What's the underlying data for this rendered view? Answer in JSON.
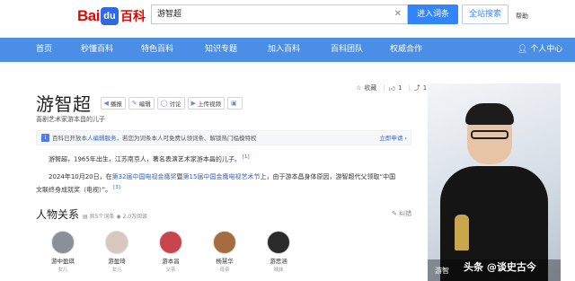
{
  "header": {
    "logo_bai": "Bai",
    "logo_du": "du",
    "logo_ke": "百科",
    "search_value": "游智超",
    "enter_button": "进入词条",
    "all_search_button": "全站搜索",
    "help": "帮助"
  },
  "nav": {
    "items": [
      "首页",
      "秒懂百科",
      "特色百科",
      "知识专题",
      "加入百科",
      "百科团队",
      "权威合作"
    ],
    "user": "个人中心"
  },
  "entry": {
    "title": "游智超",
    "tools": [
      "播报",
      "编辑",
      "讨论",
      "上传视频"
    ],
    "subtitle": "喜剧艺术家游本昌的儿子",
    "collect": "收藏",
    "like_count": "1",
    "share_count": "1"
  },
  "notice": {
    "prefix": "百科已开放",
    "link": "本人编辑服务",
    "text": "，若您为词条本人可免费认领词条、解锁热门榀模特权",
    "apply": "立即申请 ›"
  },
  "paragraphs": {
    "p1": "游智超，1965年出生，江苏南京人，著名表演艺术家游本昌的儿子。",
    "p1_ref": "[1]",
    "p2_a": "2024年10月20日，在",
    "p2_link1": "第32届中国电视金鹰奖",
    "p2_b": "暨",
    "p2_link2": "第15届中国金鹰电视艺术节",
    "p2_c": "上，由于游本昌身体原因，游智超代父领取“中国",
    "p3": "文联终身成就奖（电视）”。",
    "p3_ref": "[3]"
  },
  "relations": {
    "title": "人物关系",
    "meta_count": "共5个词条",
    "meta_views": "2.0万阅读",
    "edit": "纠错",
    "people": [
      {
        "name": "游中盈琪",
        "relation": "女儿",
        "color": "#8a8f99"
      },
      {
        "name": "游盈琦",
        "relation": "女儿",
        "color": "#d8c7bd"
      },
      {
        "name": "游本昌",
        "relation": "父亲",
        "color": "#c9454e"
      },
      {
        "name": "杨慧华",
        "relation": "母亲",
        "color": "#a56c3f"
      },
      {
        "name": "游思涵",
        "relation": "妹妹",
        "color": "#2b2b2b"
      }
    ]
  },
  "photo": {
    "caption": "游智"
  },
  "watermark": "头条 @谈史古今"
}
